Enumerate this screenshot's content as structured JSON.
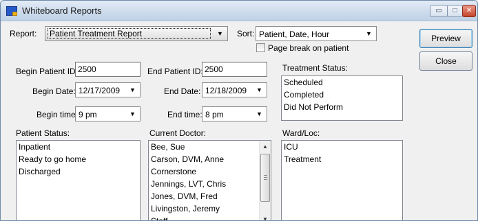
{
  "window": {
    "title": "Whiteboard Reports",
    "controls": {
      "minimize": "▭",
      "maximize": "□",
      "close": "✕"
    }
  },
  "report": {
    "label": "Report:",
    "value": "Patient Treatment Report"
  },
  "sort": {
    "label": "Sort:",
    "value": "Patient, Date, Hour",
    "page_break_label": "Page break on patient",
    "page_break_checked": false
  },
  "buttons": {
    "preview": "Preview",
    "close": "Close"
  },
  "filters": {
    "begin_patient_label": "Begin Patient ID:",
    "begin_patient_value": "2500",
    "end_patient_label": "End Patient ID:",
    "end_patient_value": "2500",
    "begin_date_label": "Begin Date:",
    "begin_date_value": "12/17/2009",
    "end_date_label": "End Date:",
    "end_date_value": "12/18/2009",
    "begin_time_label": "Begin time:",
    "begin_time_value": "9 pm",
    "end_time_label": "End time:",
    "end_time_value": "8 pm"
  },
  "treatment_status": {
    "label": "Treatment Status:",
    "items": [
      "Scheduled",
      "Completed",
      "Did Not Perform"
    ]
  },
  "patient_status": {
    "label": "Patient Status:",
    "items": [
      "Inpatient",
      "Ready to go home",
      "Discharged"
    ]
  },
  "current_doctor": {
    "label": "Current Doctor:",
    "items": [
      "Bee, Sue",
      "Carson, DVM, Anne",
      "Cornerstone",
      "Jennings, LVT, Chris",
      "Jones, DVM, Fred",
      "Livingston, Jeremy",
      "Staff"
    ]
  },
  "ward_loc": {
    "label": "Ward/Loc:",
    "items": [
      "ICU",
      "Treatment"
    ]
  },
  "icons": {
    "dropdown_arrow": "▼",
    "scroll_up": "▲",
    "scroll_down": "▼",
    "app_icon": "whiteboard-app-icon"
  },
  "colors": {
    "window_bg": "#f0f0f0",
    "titlebar": "#cfdded",
    "app_icon_blue": "#2459c9",
    "app_icon_yellow": "#f2b318"
  }
}
